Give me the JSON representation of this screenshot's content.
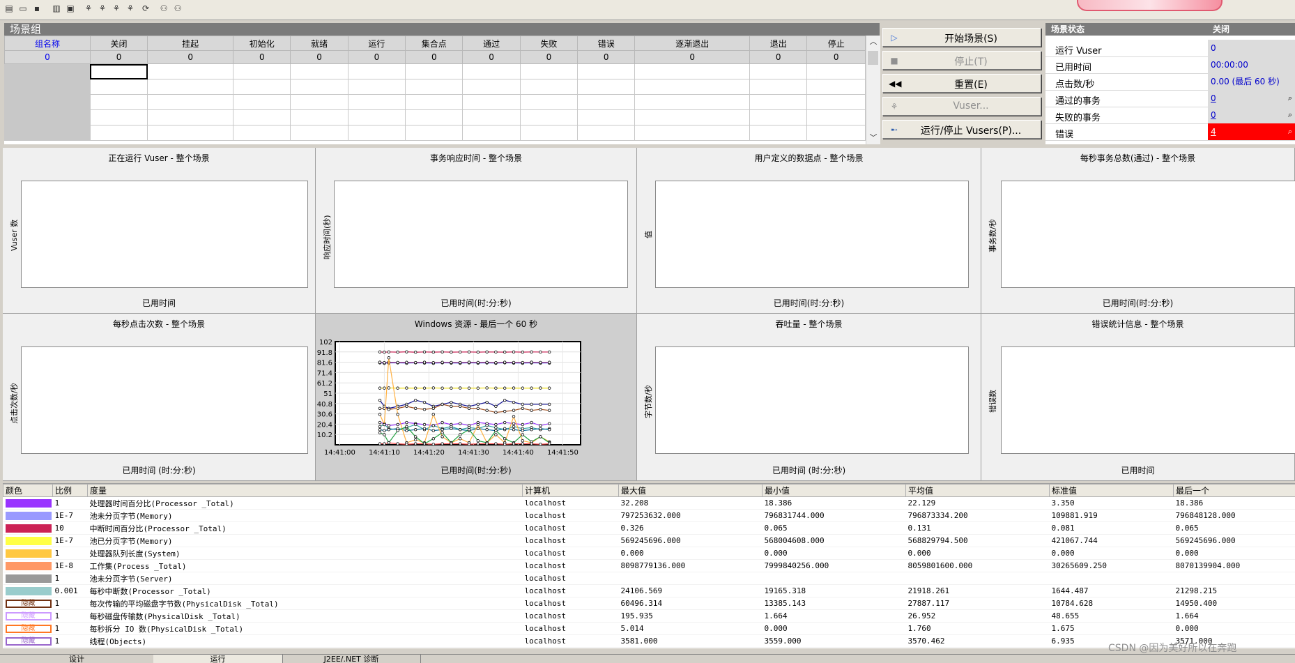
{
  "scenario_group": {
    "title": "场景组",
    "columns": [
      {
        "label": "组名称",
        "count": "0"
      },
      {
        "label": "关闭",
        "count": "0"
      },
      {
        "label": "挂起",
        "count": "0"
      },
      {
        "label": "初始化",
        "count": "0"
      },
      {
        "label": "就绪",
        "count": "0"
      },
      {
        "label": "运行",
        "count": "0"
      },
      {
        "label": "集合点",
        "count": "0"
      },
      {
        "label": "通过",
        "count": "0"
      },
      {
        "label": "失败",
        "count": "0"
      },
      {
        "label": "错误",
        "count": "0"
      },
      {
        "label": "逐渐退出",
        "count": "0"
      },
      {
        "label": "退出",
        "count": "0"
      },
      {
        "label": "停止",
        "count": "0"
      }
    ]
  },
  "buttons": {
    "start": "开始场景(S)",
    "stop": "停止(T)",
    "reset": "重置(E)",
    "vuser": "Vuser...",
    "run_stop": "运行/停止 Vusers(P)..."
  },
  "status": {
    "header": "场景状态",
    "header_value": "关闭",
    "rows": [
      {
        "label": "运行 Vuser",
        "value": "0"
      },
      {
        "label": "已用时间",
        "value": "00:00:00 (hh:mm:ss)"
      },
      {
        "label": "点击数/秒",
        "value": "0.00 (最后 60 秒)"
      },
      {
        "label": "通过的事务",
        "value": "0"
      },
      {
        "label": "失败的事务",
        "value": "0"
      },
      {
        "label": "错误",
        "value": "4"
      }
    ]
  },
  "graphs": [
    {
      "title": "正在运行 Vuser - 整个场景",
      "ylabel": "Vuser 数",
      "xlabel": "已用时间"
    },
    {
      "title": "事务响应时间 - 整个场景",
      "ylabel": "响应时间(秒)",
      "xlabel": "已用时间(时:分:秒)"
    },
    {
      "title": "用户定义的数据点 - 整个场景",
      "ylabel": "值",
      "xlabel": "已用时间(时:分:秒)"
    },
    {
      "title": "每秒事务总数(通过) - 整个场景",
      "ylabel": "事务数/秒",
      "xlabel": "已用时间(时:分:秒)"
    },
    {
      "title": "每秒点击次数 - 整个场景",
      "ylabel": "点击次数/秒",
      "xlabel": "已用时间 (时:分:秒)"
    },
    {
      "title": "Windows 资源 - 最后一个 60 秒",
      "ylabel": "",
      "xlabel": "已用时间(时:分:秒)"
    },
    {
      "title": "吞吐量 - 整个场景",
      "ylabel": "字节数/秒",
      "xlabel": "已用时间 (时:分:秒)"
    },
    {
      "title": "错误统计信息 - 整个场景",
      "ylabel": "错误数",
      "xlabel": "已用时间"
    }
  ],
  "chart_data": {
    "type": "line",
    "title": "Windows 资源 - 最后一个 60 秒",
    "xlabel": "已用时间(时:分:秒)",
    "ylabel": "",
    "ylim": [
      0,
      102
    ],
    "yticks": [
      "102",
      "91.8",
      "81.6",
      "71.4",
      "61.2",
      "51",
      "40.8",
      "30.6",
      "20.4",
      "10.2"
    ],
    "xticks": [
      "14:41:00",
      "14:41:10",
      "14:41:20",
      "14:41:30",
      "14:41:40",
      "14:41:50"
    ],
    "xlim": [
      0,
      55
    ],
    "grid": true,
    "x": [
      10,
      11,
      12,
      14,
      16,
      18,
      20,
      22,
      24,
      26,
      28,
      30,
      32,
      34,
      36,
      38,
      40,
      42,
      44,
      46,
      48
    ],
    "series": [
      {
        "color": "#cc2255",
        "values": [
          91.8,
          91.5,
          91.8,
          91.6,
          91.9,
          91.5,
          91.8,
          91.6,
          91.8,
          91.6,
          91.7,
          91.8,
          91.6,
          91.8,
          91.7,
          91.6,
          91.8,
          91.6,
          91.8,
          91.7,
          91.7
        ]
      },
      {
        "color": "#9a9aff",
        "values": [
          81,
          80.5,
          80.8,
          81,
          80.6,
          81,
          80.8,
          80.5,
          81,
          80.8,
          80.6,
          81,
          80.7,
          80.9,
          80.6,
          81,
          80.8,
          80.6,
          80.9,
          80.7,
          80.8
        ]
      },
      {
        "color": "#7a1f6a",
        "values": [
          81.6,
          81.2,
          81.6,
          81.4,
          81.5,
          81.3,
          81.6,
          81.2,
          81.5,
          81.4,
          81.3,
          81.6,
          81.4,
          81.5,
          81.2,
          81.6,
          81.4,
          81.3,
          81.6,
          81.4,
          81.5
        ]
      },
      {
        "color": "#f0e020",
        "values": [
          56,
          56,
          56.2,
          56,
          56.1,
          56,
          56,
          56.2,
          56,
          56,
          56.1,
          56,
          56,
          56.2,
          56,
          56,
          56.1,
          56,
          56,
          56.1,
          56
        ]
      },
      {
        "color": "#101090",
        "values": [
          44,
          38,
          36,
          38,
          40,
          44,
          42,
          38,
          40,
          42,
          40,
          38,
          40,
          42,
          38,
          44,
          42,
          40,
          40,
          40,
          40
        ]
      },
      {
        "color": "#a05020",
        "values": [
          36,
          36,
          35,
          36,
          38,
          36,
          35,
          36,
          40,
          38,
          38,
          36,
          36,
          34,
          32,
          33,
          34,
          36,
          34,
          35,
          34
        ]
      },
      {
        "color": "#9933ff",
        "values": [
          22,
          21,
          19,
          20,
          22,
          21,
          20,
          19,
          22,
          20,
          21,
          19,
          22,
          21,
          20,
          22,
          21,
          20,
          22,
          19,
          21
        ]
      },
      {
        "color": "#30a0a0",
        "values": [
          18,
          20,
          16,
          15,
          17,
          20,
          15,
          19,
          16,
          18,
          15,
          17,
          16,
          19,
          17,
          15,
          18,
          16,
          17,
          15,
          16
        ]
      },
      {
        "color": "#0a6a9a",
        "values": [
          15,
          14,
          15,
          16,
          14,
          15,
          16,
          14,
          15,
          16,
          15,
          14,
          16,
          15,
          14,
          16,
          15,
          14,
          15,
          16,
          15
        ]
      },
      {
        "color": "#ffb040",
        "values": [
          30,
          20,
          86,
          30,
          2,
          5,
          2,
          30,
          8,
          2,
          6,
          2,
          20,
          2,
          10,
          2,
          28,
          4,
          2,
          8,
          3
        ]
      },
      {
        "color": "#20a040",
        "values": [
          12,
          10,
          2,
          14,
          18,
          8,
          1,
          6,
          12,
          2,
          10,
          15,
          4,
          2,
          14,
          6,
          2,
          10,
          3,
          8,
          2
        ]
      },
      {
        "color": "#ff4040",
        "values": [
          1,
          1,
          2,
          1,
          0.5,
          1,
          1,
          0.5,
          1,
          1,
          1,
          0.5,
          1,
          1,
          1,
          0.5,
          1,
          1,
          1,
          0.5,
          1
        ]
      }
    ]
  },
  "measurements": {
    "headers": [
      "颜色",
      "比例",
      "度量",
      "计算机",
      "最大值",
      "最小值",
      "平均值",
      "标准值",
      "最后一个"
    ],
    "hidden_label": "隐藏",
    "rows": [
      {
        "color": "#9933ff",
        "hidden": false,
        "scale": "1",
        "measure": "处理器时间百分比(Processor _Total)",
        "machine": "localhost",
        "max": "32.208",
        "min": "18.386",
        "avg": "22.129",
        "std": "3.350",
        "last": "18.386"
      },
      {
        "color": "#9a9aff",
        "hidden": false,
        "scale": "1E-7",
        "measure": "池未分页字节(Memory)",
        "machine": "localhost",
        "max": "797253632.000",
        "min": "796831744.000",
        "avg": "796873334.200",
        "std": "109881.919",
        "last": "796848128.000"
      },
      {
        "color": "#cc2255",
        "hidden": false,
        "scale": "10",
        "measure": "中断时间百分比(Processor _Total)",
        "machine": "localhost",
        "max": "0.326",
        "min": "0.065",
        "avg": "0.131",
        "std": "0.081",
        "last": "0.065"
      },
      {
        "color": "#ffff44",
        "hidden": false,
        "scale": "1E-7",
        "measure": "池已分页字节(Memory)",
        "machine": "localhost",
        "max": "569245696.000",
        "min": "568004608.000",
        "avg": "568829794.500",
        "std": "421067.744",
        "last": "569245696.000"
      },
      {
        "color": "#ffc840",
        "hidden": false,
        "scale": "1",
        "measure": "处理器队列长度(System)",
        "machine": "localhost",
        "max": "0.000",
        "min": "0.000",
        "avg": "0.000",
        "std": "0.000",
        "last": "0.000"
      },
      {
        "color": "#ff9966",
        "hidden": false,
        "scale": "1E-8",
        "measure": "工作集(Process _Total)",
        "machine": "localhost",
        "max": "8098779136.000",
        "min": "7999840256.000",
        "avg": "8059801600.000",
        "std": "30265609.250",
        "last": "8070139904.000"
      },
      {
        "color": "#999999",
        "hidden": false,
        "scale": "1",
        "measure": "池未分页字节(Server)",
        "machine": "localhost",
        "max": "",
        "min": "",
        "avg": "",
        "std": "",
        "last": ""
      },
      {
        "color": "#99cccc",
        "hidden": false,
        "scale": "0.001",
        "measure": "每秒中断数(Processor _Total)",
        "machine": "localhost",
        "max": "24106.569",
        "min": "19165.318",
        "avg": "21918.261",
        "std": "1644.487",
        "last": "21298.215"
      },
      {
        "color": "#703010",
        "hidden": true,
        "scale": "1",
        "measure": "每次传输的平均磁盘字节数(PhysicalDisk _Total)",
        "machine": "localhost",
        "max": "60496.314",
        "min": "13385.143",
        "avg": "27887.117",
        "std": "10784.628",
        "last": "14950.400"
      },
      {
        "color": "#cc99ff",
        "hidden": true,
        "scale": "1",
        "measure": "每秒磁盘传输数(PhysicalDisk _Total)",
        "machine": "localhost",
        "max": "195.935",
        "min": "1.664",
        "avg": "26.952",
        "std": "48.655",
        "last": "1.664"
      },
      {
        "color": "#ff7722",
        "hidden": true,
        "scale": "1",
        "measure": "每秒拆分 IO 数(PhysicalDisk _Total)",
        "machine": "localhost",
        "max": "5.014",
        "min": "0.000",
        "avg": "1.760",
        "std": "1.675",
        "last": "0.000"
      },
      {
        "color": "#9966cc",
        "hidden": true,
        "scale": "1",
        "measure": "线程(Objects)",
        "machine": "localhost",
        "max": "3581.000",
        "min": "3559.000",
        "avg": "3570.462",
        "std": "6.935",
        "last": "3571.000"
      }
    ]
  },
  "watermark": "CSDN @因为美好所以在奔跑",
  "tabs": [
    "设计",
    "运行",
    "J2EE/.NET 诊断"
  ]
}
